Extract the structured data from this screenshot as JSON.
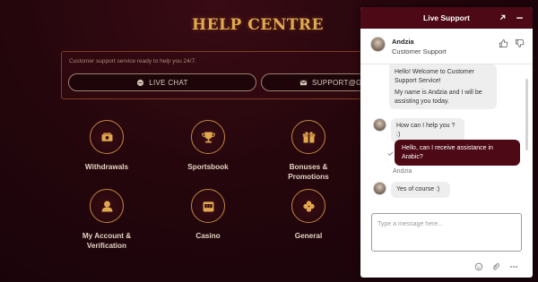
{
  "page": {
    "title": "HELP CENTRE",
    "support_text": "Customer support service ready to help you 24/7.",
    "live_chat_label": "LIVE CHAT",
    "email_label": "SUPPORT@GRA",
    "categories": [
      {
        "label": "Withdrawals",
        "icon": "money-icon"
      },
      {
        "label": "Sportsbook",
        "icon": "trophy-icon"
      },
      {
        "label": "Bonuses & Promotions",
        "icon": "gift-icon"
      },
      {
        "label": "My Account & Verification",
        "icon": "user-icon"
      },
      {
        "label": "Casino",
        "icon": "slot-machine-icon"
      },
      {
        "label": "General",
        "icon": "clover-icon"
      }
    ]
  },
  "widget": {
    "title": "Live Support",
    "agent_name": "Andzia",
    "agent_role": "Customer Support",
    "messages": [
      {
        "from": "agent",
        "text": "Hello! Welcome to Customer Support Service!"
      },
      {
        "from": "agent",
        "text": "My name is Andzia and I will be assisting you today."
      },
      {
        "from": "agent",
        "text": "How can I help you ? :)"
      },
      {
        "from": "user",
        "text": "Hello, can I receive assistance in Arabic?"
      },
      {
        "from": "agent",
        "text": "Yes of course :)"
      }
    ],
    "sender_label": "Andzia",
    "input_placeholder": "Type a message here...",
    "colors": {
      "header": "#4d0a16",
      "user_bubble": "#4d0a16",
      "accent_gold": "#c2853f"
    }
  }
}
